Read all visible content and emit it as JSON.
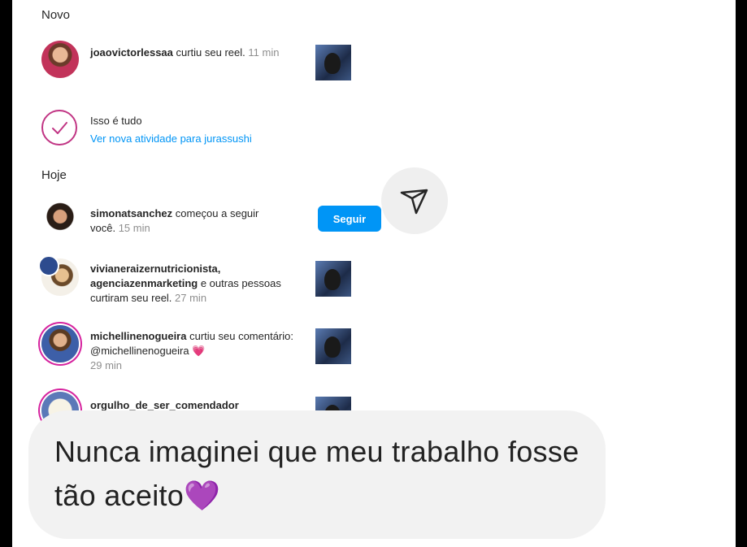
{
  "sections": {
    "novo_label": "Novo",
    "hoje_label": "Hoje"
  },
  "notifications": {
    "joao": {
      "user": "joaovictorlessaa",
      "action": " curtiu seu reel.",
      "time": " 11 min"
    },
    "all_caught_up": {
      "title": "Isso é tudo",
      "link": "Ver nova atividade para jurassushi"
    },
    "simona": {
      "user": "simonatsanchez",
      "action": " começou a seguir você.",
      "time": " 15 min",
      "follow_label": "Seguir"
    },
    "viviane": {
      "user1": "vivianeraizernutricionista,",
      "user2": "agenciazenmarketing",
      "action": " e outras pessoas curtiram seu reel.",
      "time": " 27 min"
    },
    "michelline": {
      "user": "michellinenogueira",
      "action": " curtiu seu comentário: @michellinenogueira",
      "emoji": "💗",
      "time": "29 min"
    },
    "orgulho": {
      "user": "orgulho_de_ser_comendador"
    }
  },
  "caption": {
    "text": "Nunca imaginei que meu trabalho fosse tão aceito💜"
  },
  "colors": {
    "accent": "#0095f6",
    "ring": "#d6249f",
    "caption_bg": "#f2f2f2"
  },
  "icons": {
    "send": "paper-plane-icon",
    "check": "check-icon"
  }
}
